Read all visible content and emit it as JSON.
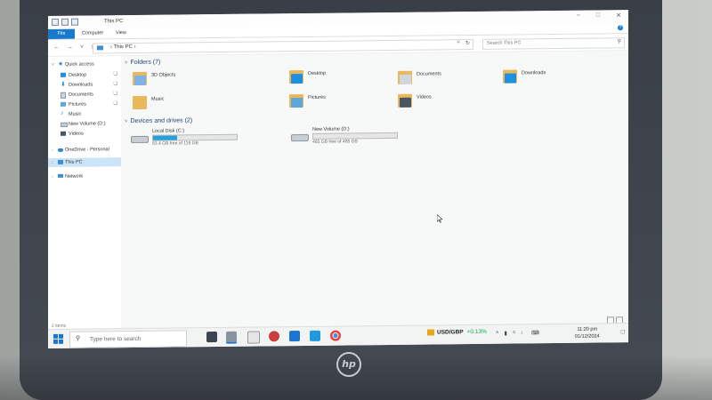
{
  "window": {
    "title": "This PC",
    "tabs": [
      "File",
      "Computer",
      "View"
    ],
    "help": "?"
  },
  "address": {
    "path": [
      "This PC"
    ],
    "search_placeholder": "Search This PC"
  },
  "sidebar": {
    "items": [
      {
        "label": "Quick access",
        "icon": "star-icon",
        "pinned": false
      },
      {
        "label": "Desktop",
        "icon": "desktop-icon",
        "pinned": true
      },
      {
        "label": "Downloads",
        "icon": "download-icon",
        "pinned": true
      },
      {
        "label": "Documents",
        "icon": "documents-icon",
        "pinned": true
      },
      {
        "label": "Pictures",
        "icon": "pictures-icon",
        "pinned": true
      },
      {
        "label": "Music",
        "icon": "music-icon",
        "pinned": false
      },
      {
        "label": "New Volume (D:)",
        "icon": "drive-icon",
        "pinned": false
      },
      {
        "label": "Videos",
        "icon": "videos-icon",
        "pinned": false
      },
      {
        "label": "OneDrive - Personal",
        "icon": "cloud-icon",
        "pinned": false
      },
      {
        "label": "This PC",
        "icon": "pc-icon",
        "pinned": false
      },
      {
        "label": "Network",
        "icon": "network-icon",
        "pinned": false
      }
    ]
  },
  "folders": {
    "header": "Folders (7)",
    "items": [
      {
        "label": "3D Objects",
        "color": "#7fb0e6"
      },
      {
        "label": "Desktop",
        "color": "#1f8fe0"
      },
      {
        "label": "Documents",
        "color": "#cfd6de"
      },
      {
        "label": "Downloads",
        "color": "#1f8fe0"
      },
      {
        "label": "Music",
        "color": "#e8b85a"
      },
      {
        "label": "Pictures",
        "color": "#5ea6d8"
      },
      {
        "label": "Videos",
        "color": "#4a5563"
      }
    ]
  },
  "drives": {
    "header": "Devices and drives (2)",
    "items": [
      {
        "label": "Local Disk (C:)",
        "free_text": "83.4 GB free of 118 GB",
        "used_fraction": 0.29
      },
      {
        "label": "New Volume (D:)",
        "free_text": "465 GB free of 465 GB",
        "used_fraction": 0.0
      }
    ]
  },
  "status": {
    "items": "2 items"
  },
  "taskbar": {
    "search_placeholder": "Type here to search",
    "fx_pair": "USD/GBP",
    "fx_change": "+0.13%",
    "time": "11:20 pm",
    "date": "01/12/2024"
  },
  "colors": {
    "accent": "#1979ca",
    "selection": "#cce4f7",
    "drive_fill": "#26a0da",
    "fx_up": "#10a84a"
  },
  "brand": "hp"
}
